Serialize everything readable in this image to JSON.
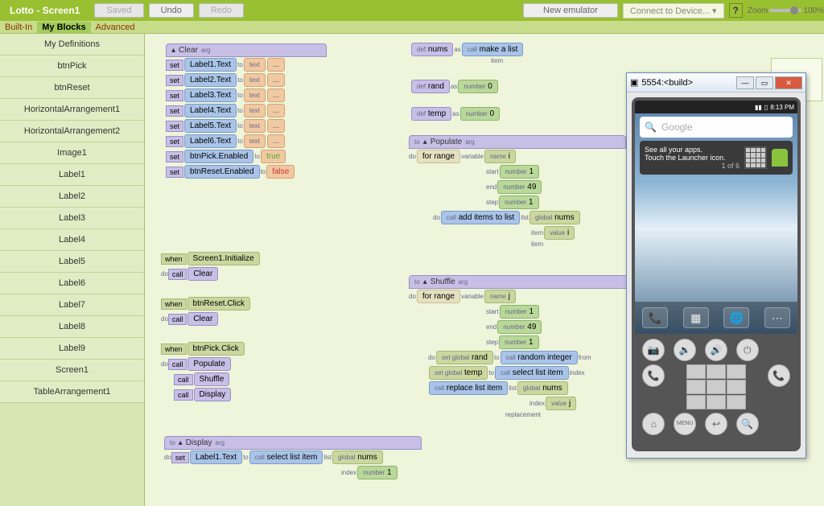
{
  "topbar": {
    "title": "Lotto - Screen1",
    "saved": "Saved",
    "undo": "Undo",
    "redo": "Redo",
    "new_emulator": "New emulator",
    "connect": "Connect to Device... ",
    "help": "?",
    "zoom_label": "Zoom",
    "zoom_pct": "100%"
  },
  "tabs": {
    "builtin": "Built-In",
    "myblocks": "My Blocks",
    "advanced": "Advanced"
  },
  "palette": [
    "My Definitions",
    "btnPick",
    "btnReset",
    "HorizontalArrangement1",
    "HorizontalArrangement2",
    "Image1",
    "Label1",
    "Label2",
    "Label3",
    "Label4",
    "Label5",
    "Label6",
    "Label7",
    "Label8",
    "Label9",
    "Screen1",
    "TableArrangement1"
  ],
  "blocks": {
    "clear": {
      "name": "Clear",
      "arg": "arg",
      "sets": [
        "Label1.Text",
        "Label2.Text",
        "Label3.Text",
        "Label4.Text",
        "Label5.Text",
        "Label6.Text"
      ],
      "text_kw": "text",
      "dots": "...",
      "to_kw": "to",
      "set_kw": "set",
      "btnPick": "btnPick.Enabled",
      "btnReset": "btnReset.Enabled",
      "true": "true",
      "false": "false"
    },
    "defs": {
      "def": "def",
      "as": "as",
      "call": "call",
      "item": "item",
      "number": "number",
      "nums": "nums",
      "make_list": "make a list",
      "rand": "rand",
      "zero": "0",
      "temp": "temp"
    },
    "populate": {
      "name": "Populate",
      "arg": "arg",
      "to": "to",
      "do": "do",
      "forrange": "for range",
      "variable": "variable",
      "name_kw": "name",
      "i": "i",
      "start": "start",
      "end": "end",
      "step": "step",
      "n1": "1",
      "n49": "49",
      "call": "call",
      "list": "list",
      "item": "item",
      "global": "global",
      "value": "value",
      "nums": "nums",
      "add": "add items to list"
    },
    "events": {
      "when": "when",
      "do": "do",
      "call": "call",
      "init": "Screen1.Initialize",
      "clear": "Clear",
      "reset": "btnReset.Click",
      "pick": "btnPick.Click",
      "populate": "Populate",
      "shuffle": "Shuffle",
      "display": "Display"
    },
    "shuffle": {
      "name": "Shuffle",
      "arg": "arg",
      "to": "to",
      "do": "do",
      "forrange": "for range",
      "variable": "variable",
      "name_kw": "name",
      "j": "j",
      "start": "start",
      "end": "end",
      "step": "step",
      "n1": "1",
      "n49": "49",
      "setglobal": "set global",
      "call": "call",
      "from": "from",
      "rand": "rand",
      "random_integer": "random integer",
      "temp": "temp",
      "select": "select list item",
      "index": "index",
      "replace": "replace list item",
      "replacement": "replacement",
      "list": "list",
      "global": "global",
      "value": "value",
      "nums": "nums"
    },
    "display": {
      "name": "Display",
      "arg": "arg",
      "to": "to",
      "do": "do",
      "set": "set",
      "label1": "Label1.Text",
      "call": "call",
      "select": "select list item",
      "list": "list",
      "index": "index",
      "global": "global",
      "nums": "nums",
      "n1": "1",
      "number": "number"
    }
  },
  "emulator": {
    "title": "5554:<build>",
    "time": "8:13 PM",
    "search_ph": "Google",
    "hint_title": "See all your apps.",
    "hint_sub": "Touch the Launcher icon.",
    "hint_page": "1 of 6",
    "menu": "MENU"
  }
}
